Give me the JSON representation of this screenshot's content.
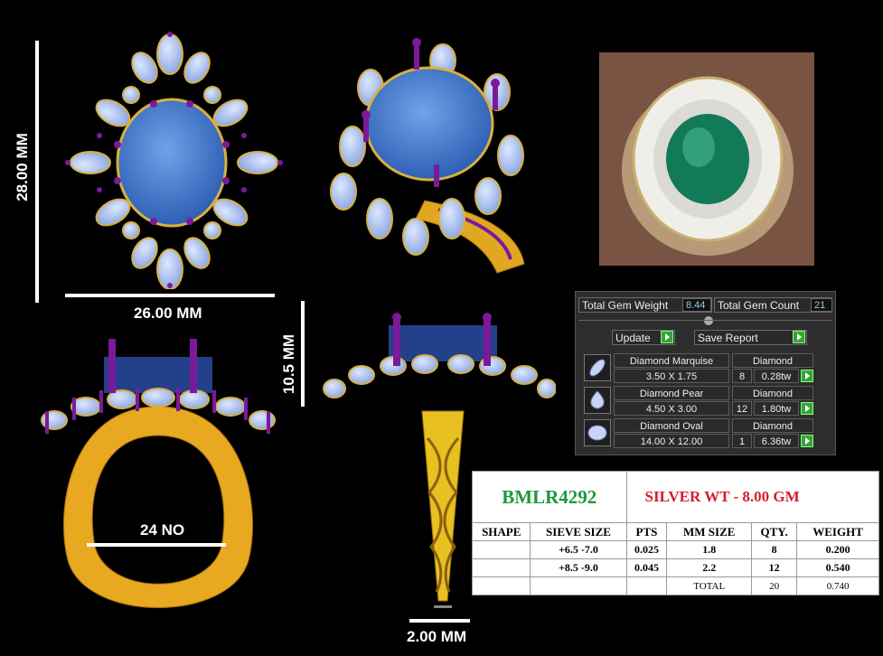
{
  "dimensions": {
    "height": "28.00 MM",
    "width": "26.00 MM",
    "depth": "10.5 MM",
    "ring_size": "24 NO",
    "shank": "2.00 MM"
  },
  "panel": {
    "total_weight_label": "Total Gem Weight",
    "total_weight_value": "8.44",
    "total_count_label": "Total Gem Count",
    "total_count_value": "21",
    "update_label": "Update",
    "save_report_label": "Save Report",
    "gems": [
      {
        "name": "Diamond Marquise",
        "type": "Diamond",
        "size": "3.50 X 1.75",
        "qty": "8",
        "weight": "0.28tw"
      },
      {
        "name": "Diamond Pear",
        "type": "Diamond",
        "size": "4.50 X 3.00",
        "qty": "12",
        "weight": "1.80tw"
      },
      {
        "name": "Diamond Oval",
        "type": "Diamond",
        "size": "14.00 X 12.00",
        "qty": "1",
        "weight": "6.36tw"
      }
    ]
  },
  "spec": {
    "code": "BMLR4292",
    "silver_wt": "SILVER WT - 8.00 GM",
    "headers": [
      "SHAPE",
      "SIEVE SIZE",
      "PTS",
      "MM SIZE",
      "QTY.",
      "WEIGHT"
    ],
    "rows": [
      [
        "",
        "+6.5 -7.0",
        "0.025",
        "1.8",
        "8",
        "0.200"
      ],
      [
        "",
        "+8.5 -9.0",
        "0.045",
        "2.2",
        "12",
        "0.540"
      ],
      [
        "",
        "",
        "",
        "TOTAL",
        "20",
        "0.740"
      ]
    ],
    "colors": {
      "code": "#1a9a3a",
      "silver": "#d4202a"
    }
  }
}
